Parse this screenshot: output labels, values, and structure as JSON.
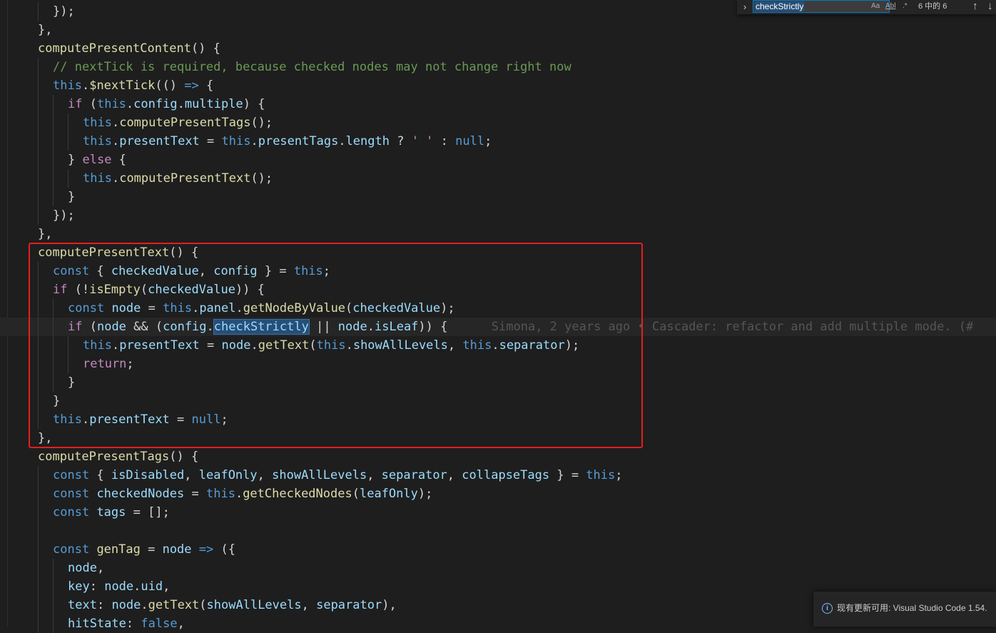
{
  "editor": {
    "lines": [
      {
        "indent": 1,
        "tokens": [
          {
            "t": "});",
            "c": "p"
          }
        ]
      },
      {
        "indent": 0,
        "tokens": [
          {
            "t": "},",
            "c": "p"
          }
        ]
      },
      {
        "indent": 0,
        "tokens": [
          {
            "t": "computePresentContent",
            "c": "fn"
          },
          {
            "t": "() {",
            "c": "p"
          }
        ]
      },
      {
        "indent": 1,
        "tokens": [
          {
            "t": "// nextTick is required, because checked nodes may not change right now",
            "c": "cmt"
          }
        ]
      },
      {
        "indent": 1,
        "tokens": [
          {
            "t": "this",
            "c": "kw"
          },
          {
            "t": ".",
            "c": "p"
          },
          {
            "t": "$nextTick",
            "c": "fn"
          },
          {
            "t": "(() ",
            "c": "p"
          },
          {
            "t": "=>",
            "c": "kw"
          },
          {
            "t": " {",
            "c": "p"
          }
        ]
      },
      {
        "indent": 2,
        "tokens": [
          {
            "t": "if",
            "c": "ctl"
          },
          {
            "t": " (",
            "c": "p"
          },
          {
            "t": "this",
            "c": "kw"
          },
          {
            "t": ".",
            "c": "p"
          },
          {
            "t": "config",
            "c": "var"
          },
          {
            "t": ".",
            "c": "p"
          },
          {
            "t": "multiple",
            "c": "var"
          },
          {
            "t": ") {",
            "c": "p"
          }
        ]
      },
      {
        "indent": 3,
        "tokens": [
          {
            "t": "this",
            "c": "kw"
          },
          {
            "t": ".",
            "c": "p"
          },
          {
            "t": "computePresentTags",
            "c": "fn"
          },
          {
            "t": "();",
            "c": "p"
          }
        ]
      },
      {
        "indent": 3,
        "tokens": [
          {
            "t": "this",
            "c": "kw"
          },
          {
            "t": ".",
            "c": "p"
          },
          {
            "t": "presentText",
            "c": "var"
          },
          {
            "t": " = ",
            "c": "p"
          },
          {
            "t": "this",
            "c": "kw"
          },
          {
            "t": ".",
            "c": "p"
          },
          {
            "t": "presentTags",
            "c": "var"
          },
          {
            "t": ".",
            "c": "p"
          },
          {
            "t": "length",
            "c": "var"
          },
          {
            "t": " ? ",
            "c": "p"
          },
          {
            "t": "' '",
            "c": "str"
          },
          {
            "t": " : ",
            "c": "p"
          },
          {
            "t": "null",
            "c": "kw"
          },
          {
            "t": ";",
            "c": "p"
          }
        ]
      },
      {
        "indent": 2,
        "tokens": [
          {
            "t": "} ",
            "c": "p"
          },
          {
            "t": "else",
            "c": "ctl"
          },
          {
            "t": " {",
            "c": "p"
          }
        ]
      },
      {
        "indent": 3,
        "tokens": [
          {
            "t": "this",
            "c": "kw"
          },
          {
            "t": ".",
            "c": "p"
          },
          {
            "t": "computePresentText",
            "c": "fn"
          },
          {
            "t": "();",
            "c": "p"
          }
        ]
      },
      {
        "indent": 2,
        "tokens": [
          {
            "t": "}",
            "c": "p"
          }
        ]
      },
      {
        "indent": 1,
        "tokens": [
          {
            "t": "});",
            "c": "p"
          }
        ]
      },
      {
        "indent": 0,
        "tokens": [
          {
            "t": "},",
            "c": "p"
          }
        ]
      },
      {
        "indent": 0,
        "tokens": [
          {
            "t": "computePresentText",
            "c": "fn"
          },
          {
            "t": "() {",
            "c": "p"
          }
        ]
      },
      {
        "indent": 1,
        "tokens": [
          {
            "t": "const",
            "c": "kw"
          },
          {
            "t": " { ",
            "c": "p"
          },
          {
            "t": "checkedValue",
            "c": "var"
          },
          {
            "t": ", ",
            "c": "p"
          },
          {
            "t": "config",
            "c": "var"
          },
          {
            "t": " } = ",
            "c": "p"
          },
          {
            "t": "this",
            "c": "kw"
          },
          {
            "t": ";",
            "c": "p"
          }
        ]
      },
      {
        "indent": 1,
        "tokens": [
          {
            "t": "if",
            "c": "ctl"
          },
          {
            "t": " (!",
            "c": "p"
          },
          {
            "t": "isEmpty",
            "c": "fn"
          },
          {
            "t": "(",
            "c": "p"
          },
          {
            "t": "checkedValue",
            "c": "var"
          },
          {
            "t": ")) {",
            "c": "p"
          }
        ]
      },
      {
        "indent": 2,
        "tokens": [
          {
            "t": "const",
            "c": "kw"
          },
          {
            "t": " ",
            "c": "p"
          },
          {
            "t": "node",
            "c": "var"
          },
          {
            "t": " = ",
            "c": "p"
          },
          {
            "t": "this",
            "c": "kw"
          },
          {
            "t": ".",
            "c": "p"
          },
          {
            "t": "panel",
            "c": "var"
          },
          {
            "t": ".",
            "c": "p"
          },
          {
            "t": "getNodeByValue",
            "c": "fn"
          },
          {
            "t": "(",
            "c": "p"
          },
          {
            "t": "checkedValue",
            "c": "var"
          },
          {
            "t": ");",
            "c": "p"
          }
        ]
      },
      {
        "indent": 2,
        "current": true,
        "tokens": [
          {
            "t": "if",
            "c": "ctl"
          },
          {
            "t": " (",
            "c": "p"
          },
          {
            "t": "node",
            "c": "var"
          },
          {
            "t": " && (",
            "c": "p"
          },
          {
            "t": "config",
            "c": "var"
          },
          {
            "t": ".",
            "c": "p"
          },
          {
            "t": "checkStrictly",
            "c": "var",
            "match": true
          },
          {
            "t": " || ",
            "c": "p"
          },
          {
            "t": "node",
            "c": "var"
          },
          {
            "t": ".",
            "c": "p"
          },
          {
            "t": "isLeaf",
            "c": "var"
          },
          {
            "t": ")) {",
            "c": "p"
          },
          {
            "t": "      Simona, 2 years ago • Cascader: refactor and add multiple mode. (#",
            "c": "blame"
          }
        ]
      },
      {
        "indent": 3,
        "tokens": [
          {
            "t": "this",
            "c": "kw"
          },
          {
            "t": ".",
            "c": "p"
          },
          {
            "t": "presentText",
            "c": "var"
          },
          {
            "t": " = ",
            "c": "p"
          },
          {
            "t": "node",
            "c": "var"
          },
          {
            "t": ".",
            "c": "p"
          },
          {
            "t": "getText",
            "c": "fn"
          },
          {
            "t": "(",
            "c": "p"
          },
          {
            "t": "this",
            "c": "kw"
          },
          {
            "t": ".",
            "c": "p"
          },
          {
            "t": "showAllLevels",
            "c": "var"
          },
          {
            "t": ", ",
            "c": "p"
          },
          {
            "t": "this",
            "c": "kw"
          },
          {
            "t": ".",
            "c": "p"
          },
          {
            "t": "separator",
            "c": "var"
          },
          {
            "t": ");",
            "c": "p"
          }
        ]
      },
      {
        "indent": 3,
        "tokens": [
          {
            "t": "return",
            "c": "ctl"
          },
          {
            "t": ";",
            "c": "p"
          }
        ]
      },
      {
        "indent": 2,
        "tokens": [
          {
            "t": "}",
            "c": "p"
          }
        ]
      },
      {
        "indent": 1,
        "tokens": [
          {
            "t": "}",
            "c": "p"
          }
        ]
      },
      {
        "indent": 1,
        "tokens": [
          {
            "t": "this",
            "c": "kw"
          },
          {
            "t": ".",
            "c": "p"
          },
          {
            "t": "presentText",
            "c": "var"
          },
          {
            "t": " = ",
            "c": "p"
          },
          {
            "t": "null",
            "c": "kw"
          },
          {
            "t": ";",
            "c": "p"
          }
        ]
      },
      {
        "indent": 0,
        "tokens": [
          {
            "t": "},",
            "c": "p"
          }
        ]
      },
      {
        "indent": 0,
        "tokens": [
          {
            "t": "computePresentTags",
            "c": "fn"
          },
          {
            "t": "() {",
            "c": "p"
          }
        ]
      },
      {
        "indent": 1,
        "tokens": [
          {
            "t": "const",
            "c": "kw"
          },
          {
            "t": " { ",
            "c": "p"
          },
          {
            "t": "isDisabled",
            "c": "var"
          },
          {
            "t": ", ",
            "c": "p"
          },
          {
            "t": "leafOnly",
            "c": "var"
          },
          {
            "t": ", ",
            "c": "p"
          },
          {
            "t": "showAllLevels",
            "c": "var"
          },
          {
            "t": ", ",
            "c": "p"
          },
          {
            "t": "separator",
            "c": "var"
          },
          {
            "t": ", ",
            "c": "p"
          },
          {
            "t": "collapseTags",
            "c": "var"
          },
          {
            "t": " } = ",
            "c": "p"
          },
          {
            "t": "this",
            "c": "kw"
          },
          {
            "t": ";",
            "c": "p"
          }
        ]
      },
      {
        "indent": 1,
        "tokens": [
          {
            "t": "const",
            "c": "kw"
          },
          {
            "t": " ",
            "c": "p"
          },
          {
            "t": "checkedNodes",
            "c": "var"
          },
          {
            "t": " = ",
            "c": "p"
          },
          {
            "t": "this",
            "c": "kw"
          },
          {
            "t": ".",
            "c": "p"
          },
          {
            "t": "getCheckedNodes",
            "c": "fn"
          },
          {
            "t": "(",
            "c": "p"
          },
          {
            "t": "leafOnly",
            "c": "var"
          },
          {
            "t": ");",
            "c": "p"
          }
        ]
      },
      {
        "indent": 1,
        "tokens": [
          {
            "t": "const",
            "c": "kw"
          },
          {
            "t": " ",
            "c": "p"
          },
          {
            "t": "tags",
            "c": "var"
          },
          {
            "t": " = [];",
            "c": "p"
          }
        ]
      },
      {
        "indent": 1,
        "tokens": []
      },
      {
        "indent": 1,
        "tokens": [
          {
            "t": "const",
            "c": "kw"
          },
          {
            "t": " ",
            "c": "p"
          },
          {
            "t": "genTag",
            "c": "fn"
          },
          {
            "t": " = ",
            "c": "p"
          },
          {
            "t": "node",
            "c": "var"
          },
          {
            "t": " ",
            "c": "p"
          },
          {
            "t": "=>",
            "c": "kw"
          },
          {
            "t": " ({",
            "c": "p"
          }
        ]
      },
      {
        "indent": 2,
        "tokens": [
          {
            "t": "node",
            "c": "var"
          },
          {
            "t": ",",
            "c": "p"
          }
        ]
      },
      {
        "indent": 2,
        "tokens": [
          {
            "t": "key",
            "c": "var"
          },
          {
            "t": ": ",
            "c": "p"
          },
          {
            "t": "node",
            "c": "var"
          },
          {
            "t": ".",
            "c": "p"
          },
          {
            "t": "uid",
            "c": "var"
          },
          {
            "t": ",",
            "c": "p"
          }
        ]
      },
      {
        "indent": 2,
        "tokens": [
          {
            "t": "text",
            "c": "var"
          },
          {
            "t": ": ",
            "c": "p"
          },
          {
            "t": "node",
            "c": "var"
          },
          {
            "t": ".",
            "c": "p"
          },
          {
            "t": "getText",
            "c": "fn"
          },
          {
            "t": "(",
            "c": "p"
          },
          {
            "t": "showAllLevels",
            "c": "var"
          },
          {
            "t": ", ",
            "c": "p"
          },
          {
            "t": "separator",
            "c": "var"
          },
          {
            "t": "),",
            "c": "p"
          }
        ]
      },
      {
        "indent": 2,
        "tokens": [
          {
            "t": "hitState",
            "c": "var"
          },
          {
            "t": ": ",
            "c": "p"
          },
          {
            "t": "false",
            "c": "kw"
          },
          {
            "t": ",",
            "c": "p"
          }
        ]
      }
    ]
  },
  "find_widget": {
    "toggle_icon": "chevron-right-icon",
    "query": "checkStrictly",
    "match_case_label": "Aa",
    "whole_word_label": "Abl",
    "regex_label": ".*",
    "result_count": "6 中的 6",
    "prev_icon": "arrow-up-icon",
    "next_icon": "arrow-down-icon"
  },
  "notification": {
    "icon": "info-icon",
    "text": "现有更新可用: Visual Studio Code 1.54."
  },
  "colors": {
    "editor_background": "#1e1e1e",
    "keyword": "#569cd6",
    "control": "#c586c0",
    "function": "#dcdcaa",
    "variable": "#9cdcfe",
    "comment": "#6a9955",
    "highlight_box": "#e51e1e"
  }
}
